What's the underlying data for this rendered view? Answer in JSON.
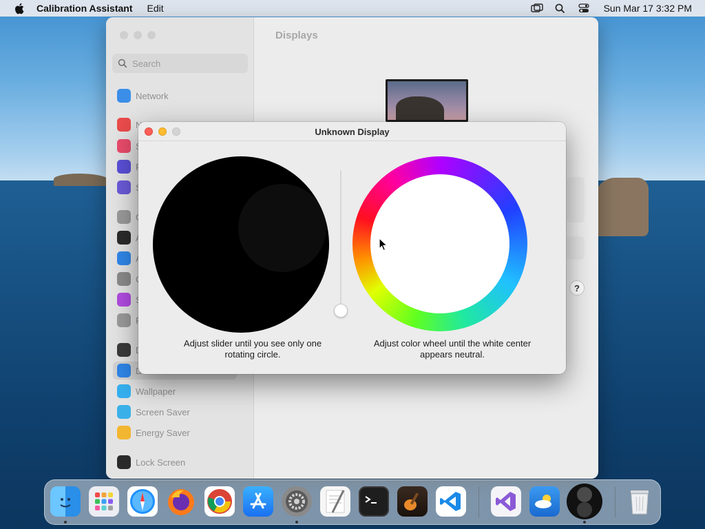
{
  "menubar": {
    "app_name": "Calibration Assistant",
    "menu_edit": "Edit",
    "clock": "Sun Mar 17  3:32 PM"
  },
  "settings": {
    "search_placeholder": "Search",
    "page_title": "Displays",
    "sidebar_items": [
      {
        "label": "Network",
        "color": "#3b8ee8"
      },
      {
        "label": "N",
        "color": "#e94b4b"
      },
      {
        "label": "S",
        "color": "#e94b6b"
      },
      {
        "label": "F",
        "color": "#5a4fd6"
      },
      {
        "label": "S",
        "color": "#6a5ad8"
      },
      {
        "label": "G",
        "color": "#9a9a9a"
      },
      {
        "label": "A",
        "color": "#2a2a2a"
      },
      {
        "label": "A",
        "color": "#2f86e8"
      },
      {
        "label": "C",
        "color": "#8a8a8a"
      },
      {
        "label": "S",
        "color": "#b04be0"
      },
      {
        "label": "P",
        "color": "#9a9a9a"
      },
      {
        "label": "D",
        "color": "#3a3a3a"
      },
      {
        "label": "D",
        "color": "#2f86e8"
      },
      {
        "label": "Wallpaper",
        "color": "#35b0f0"
      },
      {
        "label": "Screen Saver",
        "color": "#3ab0e8"
      },
      {
        "label": "Energy Saver",
        "color": "#f2b630"
      },
      {
        "label": "Lock Screen",
        "color": "#2a2a2a"
      }
    ],
    "help_label": "?"
  },
  "dialog": {
    "title": "Unknown Display",
    "left_caption_line1": "Adjust slider until you see only one",
    "left_caption_line2": "rotating circle.",
    "right_caption_line1": "Adjust color wheel until the white center",
    "right_caption_line2": "appears neutral.",
    "slider_value": 0
  },
  "dock": {
    "apps": [
      {
        "name": "finder-icon",
        "color": "#2a9df4"
      },
      {
        "name": "launchpad-icon",
        "color": "#e8e8ee"
      },
      {
        "name": "safari-icon",
        "color": "#1e90ff"
      },
      {
        "name": "firefox-icon",
        "color": "#ff6a00"
      },
      {
        "name": "chrome-icon",
        "color": "#ffffff"
      },
      {
        "name": "app-store-icon",
        "color": "#1a8cff"
      },
      {
        "name": "system-settings-icon",
        "color": "#7d7d7d"
      },
      {
        "name": "textedit-icon",
        "color": "#f4f4f4"
      },
      {
        "name": "terminal-icon",
        "color": "#1a1a1a"
      },
      {
        "name": "garageband-icon",
        "color": "#f09020"
      },
      {
        "name": "vscode-icon",
        "color": "#ffffff"
      },
      {
        "name": "visual-studio-icon",
        "color": "#f4f4f8"
      },
      {
        "name": "weather-icon",
        "color": "#2a88e0"
      },
      {
        "name": "calibration-assistant-icon",
        "color": "#111111"
      },
      {
        "name": "trash-icon",
        "color": "#e6e8ea"
      }
    ]
  }
}
